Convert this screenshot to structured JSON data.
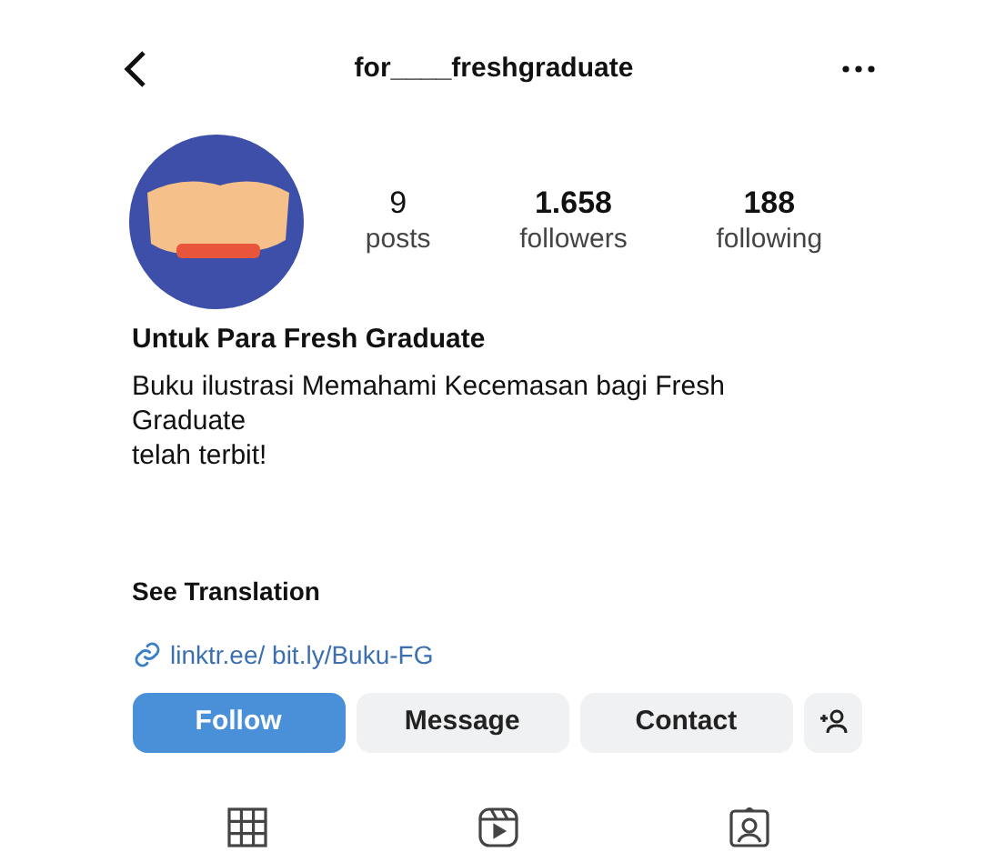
{
  "header": {
    "username": "for____freshgraduate"
  },
  "stats": [
    {
      "count": "9",
      "label": "posts"
    },
    {
      "count": "1.658",
      "label": "followers"
    },
    {
      "count": "188",
      "label": "following"
    }
  ],
  "profile": {
    "name": "Untuk Para Fresh Graduate",
    "bio_lines": [
      "Buku ilustrasi Memahami Kecemasan bagi Fresh Graduate",
      "telah terbit!"
    ],
    "see_translation": "See Translation",
    "link": "linktr.ee/ bit.ly/Buku-FG"
  },
  "buttons": [
    {
      "label": "Follow",
      "kind": "primary"
    },
    {
      "label": "Message",
      "kind": "secondary"
    },
    {
      "label": "Contact",
      "kind": "secondary"
    }
  ]
}
